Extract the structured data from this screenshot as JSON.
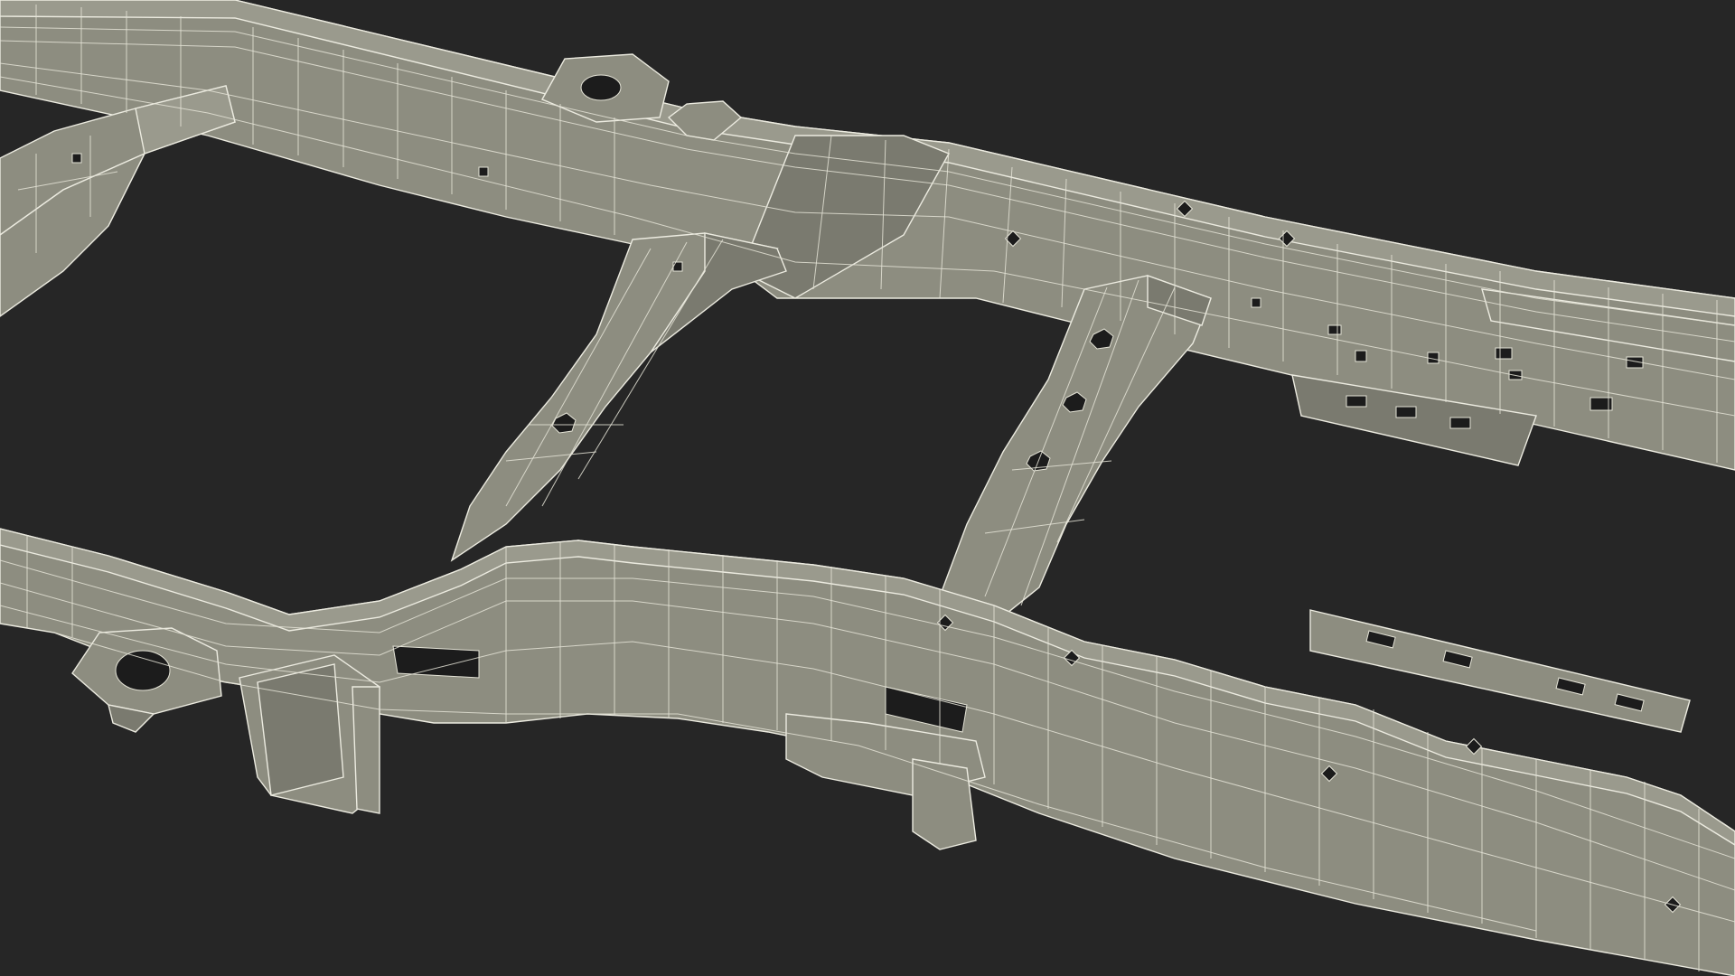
{
  "scene": {
    "subject": "vehicle-frame-wireframe",
    "background_color": "#262626",
    "surface_color": "#8d8d80",
    "wire_color": "#ecebe0"
  }
}
